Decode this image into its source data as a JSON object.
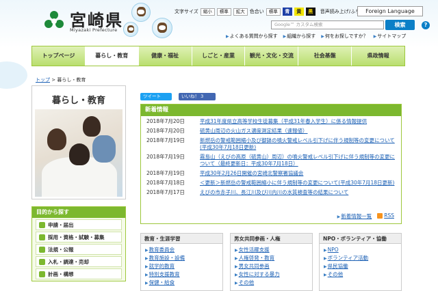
{
  "header": {
    "logo_text": "宮崎県",
    "logo_sub": "Miyazaki Prefecture",
    "util": {
      "font_size_label": "文字サイズ",
      "shrink": "縮小",
      "standard": "標準",
      "enlarge": "拡大",
      "color_label": "色合い",
      "color_standard": "標準",
      "color_blue": "青",
      "color_yellow": "黄",
      "color_black": "黒",
      "voice": "音声読み上げ/ふりがな",
      "foreign": "Foreign Language"
    },
    "search": {
      "placeholder": "Google™ カスタム検索",
      "button": "検索",
      "help": "?"
    },
    "links": [
      "よくある質問から探す",
      "組織から探す",
      "何をお探しですか？",
      "サイトマップ"
    ]
  },
  "nav": [
    "トップページ",
    "暮らし・教育",
    "健康・福祉",
    "しごと・産業",
    "観光・文化・交流",
    "社会基盤",
    "県政情報"
  ],
  "breadcrumb": {
    "top": "トップ",
    "sep": ">",
    "current": "暮らし・教育"
  },
  "left": {
    "section_title": "暮らし・教育",
    "purpose_head": "目的から探す",
    "purpose_items": [
      "申請・届出",
      "採用・資格・試験・募集",
      "法規・公報",
      "入札・調達・売却",
      "計画・構想"
    ]
  },
  "social": {
    "tweet": "ツイート",
    "like": "いいね！ 3"
  },
  "news": {
    "head": "新着情報",
    "items": [
      {
        "date": "2018年7月20日",
        "title": "平成31年度県立高等学校生徒募集（平成31年春入学生）に係る情報提供"
      },
      {
        "date": "2018年7月20日",
        "title": "硫黄山周辺の火山ガス濃度測定結果（速報値）"
      },
      {
        "date": "2018年7月19日",
        "title": "新燃岳の警戒範囲縮小及び御鉢の噴火警戒レベル引下げに伴う規制等の変更について(平成30年7月18日更新)"
      },
      {
        "date": "2018年7月19日",
        "title": "霧島山（えびの高原（硫黄山）周辺）の噴火警戒レベル引下げに伴う規制等の変更について（最終更新日：平成30年7月18日）"
      },
      {
        "date": "2018年7月19日",
        "title": "平成30年2月26日開催の宮崎北警察署協議会"
      },
      {
        "date": "2018年7月18日",
        "title": "＜更新＞新燃岳の警戒範囲縮小に伴う規制等の変更について(平成30年7月18日更新)"
      },
      {
        "date": "2018年7月17日",
        "title": "えびの市赤子川、長江川及び川内川の水質検査等の結果について"
      }
    ],
    "more": "新着情報一覧",
    "rss": "RSS"
  },
  "categories": [
    {
      "head": "教育・生涯学習",
      "items": [
        "教育委員会",
        "教育施設・設備",
        "就学的教育",
        "特別支援教育",
        "保健・給食"
      ]
    },
    {
      "head": "男女共同参画・人権",
      "items": [
        "女性活躍支援",
        "人権啓発・教育",
        "男女共同参画",
        "女性に対する暴力",
        "その他"
      ]
    },
    {
      "head": "NPO・ボランティア・協働",
      "items": [
        "NPO",
        "ボランティア活動",
        "県民協働",
        "その他"
      ]
    }
  ]
}
